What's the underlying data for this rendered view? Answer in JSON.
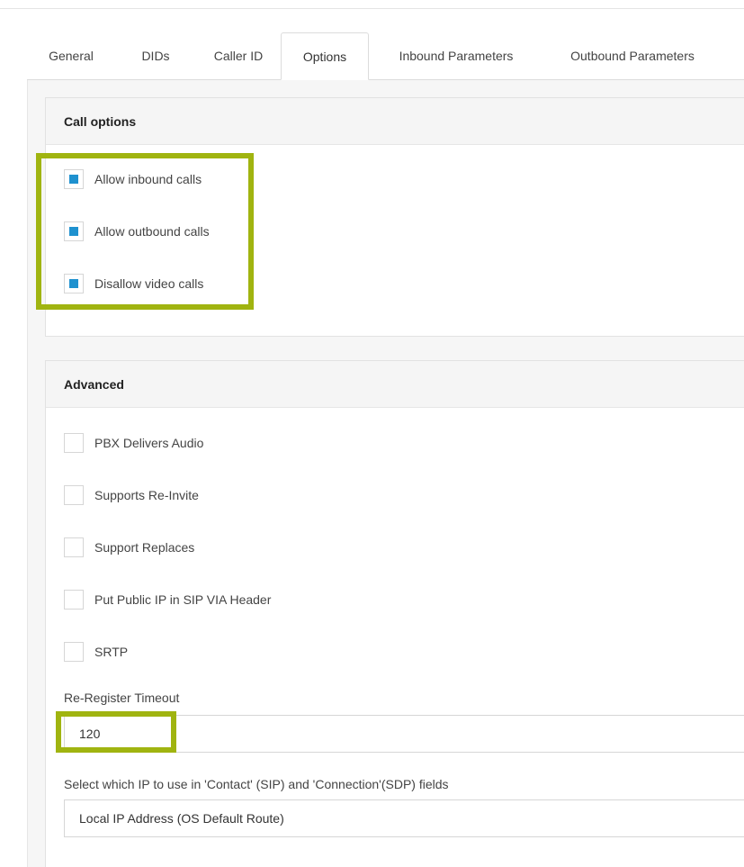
{
  "tabs": [
    {
      "label": "General"
    },
    {
      "label": "DIDs"
    },
    {
      "label": "Caller ID"
    },
    {
      "label": "Options"
    },
    {
      "label": "Inbound Parameters"
    },
    {
      "label": "Outbound Parameters"
    }
  ],
  "active_tab": "Options",
  "call_options": {
    "title": "Call options",
    "items": [
      {
        "label": "Allow inbound calls",
        "checked": true
      },
      {
        "label": "Allow outbound calls",
        "checked": true
      },
      {
        "label": "Disallow video calls",
        "checked": true
      }
    ]
  },
  "advanced": {
    "title": "Advanced",
    "items": [
      {
        "label": "PBX Delivers Audio",
        "checked": false
      },
      {
        "label": "Supports Re-Invite",
        "checked": false
      },
      {
        "label": "Support Replaces",
        "checked": false
      },
      {
        "label": "Put Public IP in SIP VIA Header",
        "checked": false
      },
      {
        "label": "SRTP",
        "checked": false
      }
    ],
    "reregister_label": "Re-Register Timeout",
    "reregister_value": "120",
    "ip_select_label": "Select which IP to use in 'Contact' (SIP) and 'Connection'(SDP) fields",
    "ip_select_value": "Local IP Address (OS Default Route)"
  },
  "colors": {
    "accent": "#1e91cf",
    "highlight": "#a0b410"
  }
}
